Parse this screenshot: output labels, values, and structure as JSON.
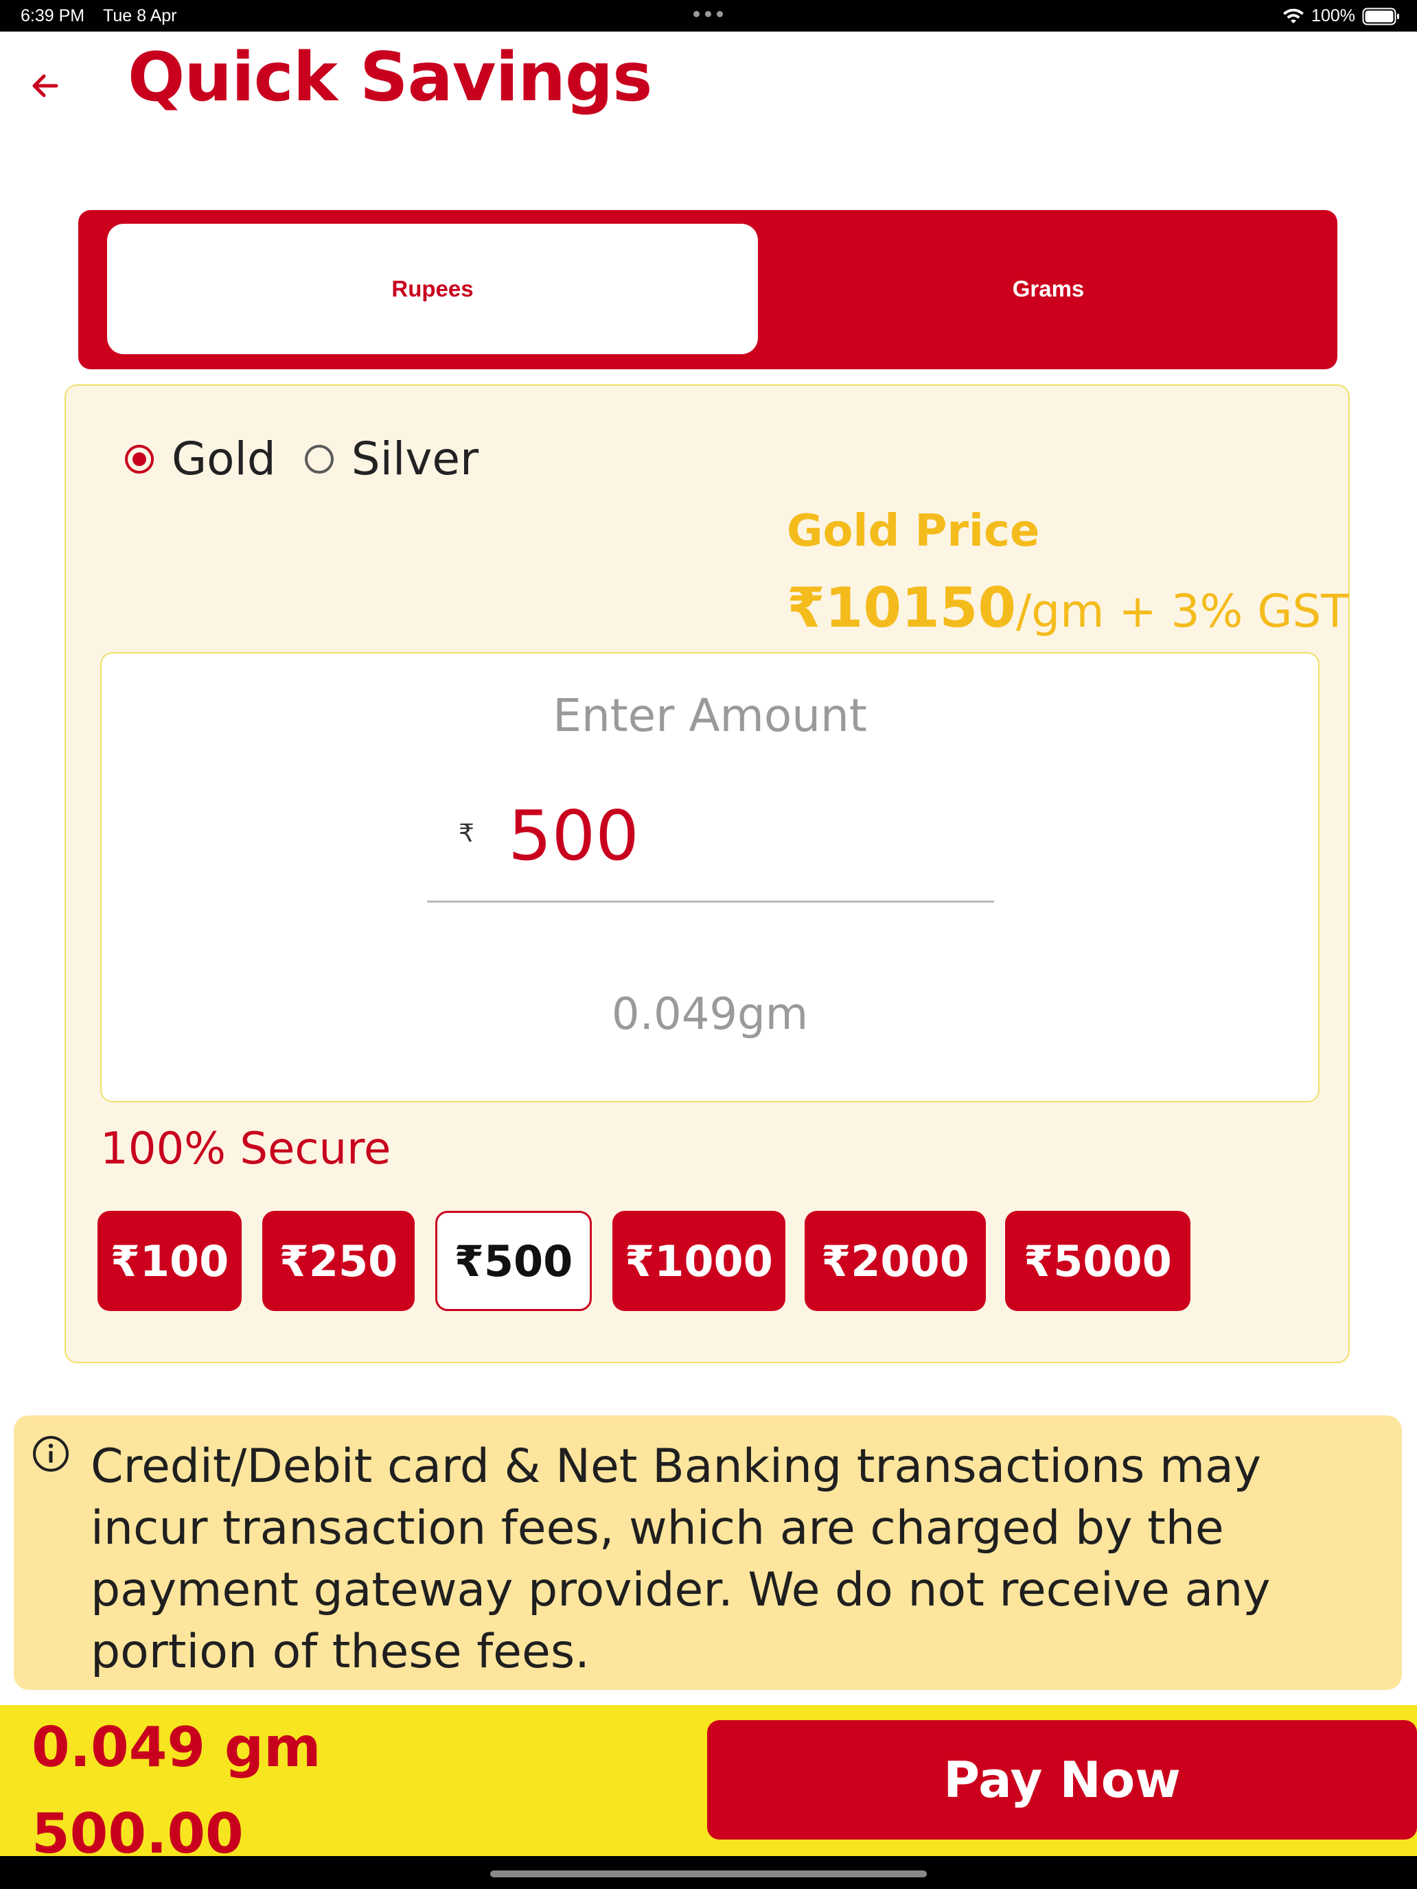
{
  "status_bar": {
    "time": "6:39 PM",
    "date": "Tue 8 Apr",
    "battery": "100%"
  },
  "header": {
    "back_icon": "arrow-left-icon",
    "title": "Quick Savings"
  },
  "mode_tabs": {
    "items": [
      {
        "label": "Rupees",
        "selected": true
      },
      {
        "label": "Grams",
        "selected": false
      }
    ]
  },
  "metal_options": [
    {
      "label": "Gold",
      "selected": true
    },
    {
      "label": "Silver",
      "selected": false
    }
  ],
  "price": {
    "title": "Gold Price",
    "value": "₹10150",
    "suffix": "/gm + 3% GST"
  },
  "amount": {
    "label": "Enter Amount",
    "currency": "₹",
    "value": "500",
    "grams_preview": "0.049gm"
  },
  "secure_text": "100% Secure",
  "quick_amounts": [
    {
      "label": "₹100",
      "selected": false
    },
    {
      "label": "₹250",
      "selected": false
    },
    {
      "label": "₹500",
      "selected": true
    },
    {
      "label": "₹1000",
      "selected": false
    },
    {
      "label": "₹2000",
      "selected": false
    },
    {
      "label": "₹5000",
      "selected": false
    }
  ],
  "notice": {
    "icon": "info-icon",
    "text": "Credit/Debit card & Net Banking transactions may incur transaction fees, which are charged by the payment gateway provider. We do not receive any portion of these fees."
  },
  "footer": {
    "grams": "0.049 gm",
    "amount": "500.00",
    "pay_label": "Pay Now"
  },
  "colors": {
    "brand_red": "#cc001d",
    "gold_accent": "#f4bb1c",
    "panel_cream": "#fdf5e4",
    "notice_yellow": "#fde59e",
    "footer_yellow": "#f7e61f"
  }
}
